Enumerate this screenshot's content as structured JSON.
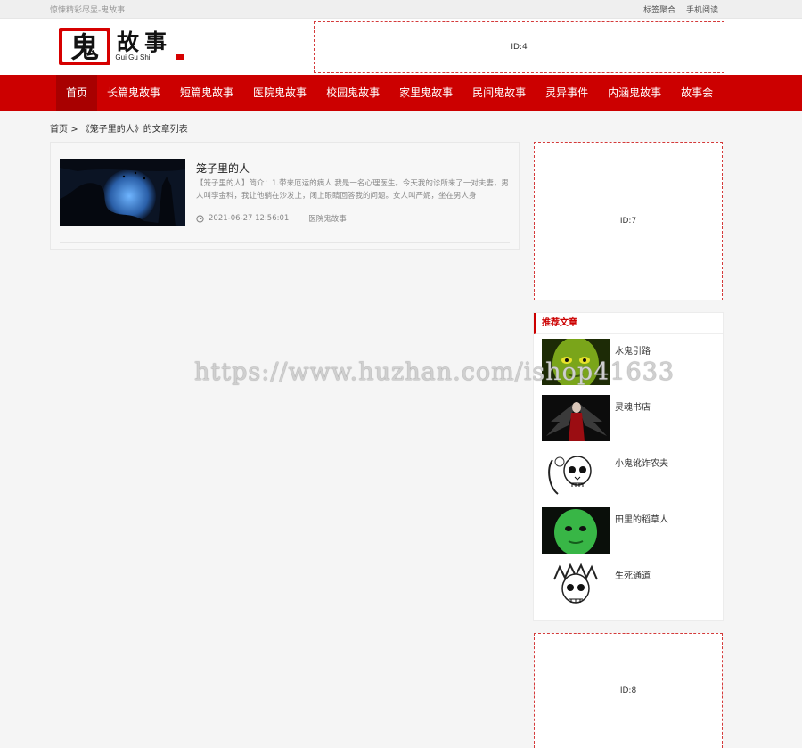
{
  "topbar": {
    "slogan": "惊悚精彩尽显-鬼故事",
    "links": [
      "标签聚合",
      "手机阅读"
    ]
  },
  "logo": {
    "main": "鬼故事",
    "sub": "Gui Gu Shi"
  },
  "ads": {
    "top": "ID:4",
    "side1": "ID:7",
    "side2": "ID:8"
  },
  "nav": {
    "items": [
      "首页",
      "长篇鬼故事",
      "短篇鬼故事",
      "医院鬼故事",
      "校园鬼故事",
      "家里鬼故事",
      "民间鬼故事",
      "灵异事件",
      "内涵鬼故事",
      "故事会"
    ]
  },
  "breadcrumb": {
    "home": "首页",
    "sep": ">",
    "current": "《笼子里的人》的文章列表"
  },
  "article": {
    "title": "笼子里的人",
    "excerpt": "【笼子里的人】简介：1.带来厄运的病人  我是一名心理医生。今天我的诊所来了一对夫妻，男人叫李金科，我让他躺在沙发上，闭上眼睛回答我的问题。女人叫严妮，坐在男人身",
    "datetime": "2021-06-27 12:56:01",
    "category": "医院鬼故事"
  },
  "recommend": {
    "title": "推荐文章",
    "items": [
      "水鬼引路",
      "灵魂书店",
      "小鬼讹诈农夫",
      "田里的稻草人",
      "生死通道"
    ]
  },
  "watermark": "https://www.huzhan.com/ishop41633",
  "colors": {
    "brand": "#cc0000",
    "nav_active": "#a80000",
    "ad_border": "#d43a3a"
  }
}
